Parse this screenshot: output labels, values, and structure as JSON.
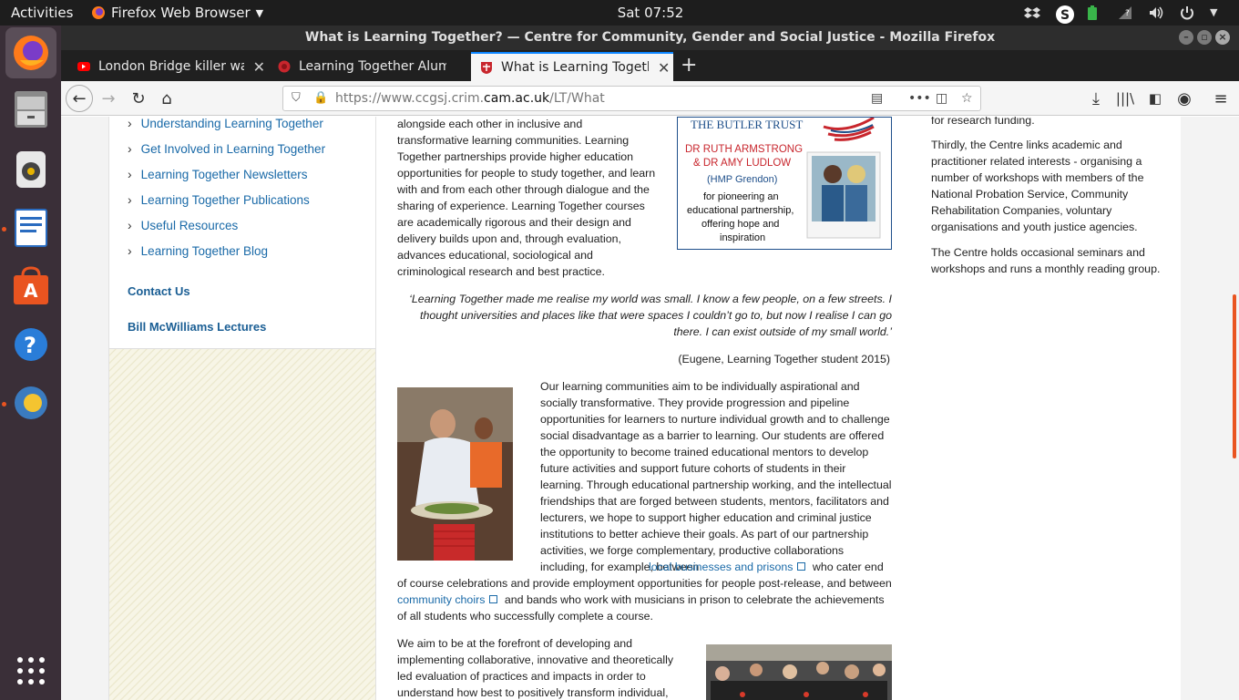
{
  "topbar": {
    "activities": "Activities",
    "app_name": "Firefox Web Browser",
    "clock": "Sat 07:52"
  },
  "window": {
    "title": "What is Learning Together? — Centre for Community, Gender and Social Justice - Mozilla Firefox"
  },
  "tabs": [
    {
      "label": "London Bridge killer was",
      "icon": "youtube-icon"
    },
    {
      "label": "Learning Together Alumn",
      "icon": "site-icon"
    },
    {
      "label": "What is Learning Togethe",
      "icon": "cambridge-shield-icon"
    }
  ],
  "url": {
    "prefix": "https://www.ccgsj.crim.",
    "domain": "cam.ac.uk",
    "path": "/LT/What"
  },
  "sidebar": {
    "items": [
      "Understanding Learning Together",
      "Get Involved in Learning Together",
      "Learning Together Newsletters",
      "Learning Together Publications",
      "Useful Resources",
      "Learning Together Blog"
    ],
    "contact": "Contact Us",
    "lectures": "Bill McWilliams Lectures"
  },
  "main": {
    "intro": "alongside each other in inclusive and transformative learning communities. Learning Together partnerships provide higher education opportunities for people to study together, and learn with and from each other through dialogue and the sharing of experience. Learning Together courses are academically rigorous and their design and delivery builds upon and, through evaluation, advances educational, sociological and criminological research and best practice.",
    "quote": "‘Learning Together made me realise my world was small. I know a few people, on a few streets. I thought universities and places like that were spaces I couldn’t go to, but now I realise I can go there. I can exist outside of my small world.’",
    "attribution": "(Eugene, Learning Together student 2015)",
    "para2_a": "Our learning communities aim to be individually aspirational and socially transformative. They provide progression and pipeline opportunities for learners to nurture individual growth and to challenge social disadvantage as a barrier to learning. Our students are offered the opportunity to become trained educational mentors to develop future activities and support future cohorts of students in their learning. Through educational partnership working, and the intellectual friendships that are forged between students, mentors, facilitators and lecturers, we hope to support higher education and criminal justice institutions to better achieve their goals. As part of our partnership activities, we forge complementary, productive collaborations including, for example, between",
    "link1": "local businesses and prisons",
    "para2_b": "who cater end of course celebrations and provide employment opportunities for people post-release, and between",
    "link2": "community choirs",
    "para2_c": "and bands who work with musicians in prison to celebrate the achievements of all students who successfully complete a course.",
    "para3": "We aim to be at the forefront of developing and implementing collaborative, innovative and theoretically led evaluation of practices and impacts in order to understand how best to positively transform individual,"
  },
  "butler": {
    "org": "THE BUTLER TRUST",
    "names": "DR RUTH ARMSTRONG & DR AMY LUDLOW",
    "place": "(HMP Grendon)",
    "citation": "for pioneering an educational partnership, offering hope and inspiration"
  },
  "right": {
    "top": "for research funding.",
    "p1": "Thirdly, the Centre links academic and practitioner related interests - organising a number of workshops with members of the National Probation Service, Community Rehabilitation Companies, voluntary organisations and youth justice agencies.",
    "p2": "The Centre holds occasional seminars and workshops and runs a monthly reading group."
  }
}
